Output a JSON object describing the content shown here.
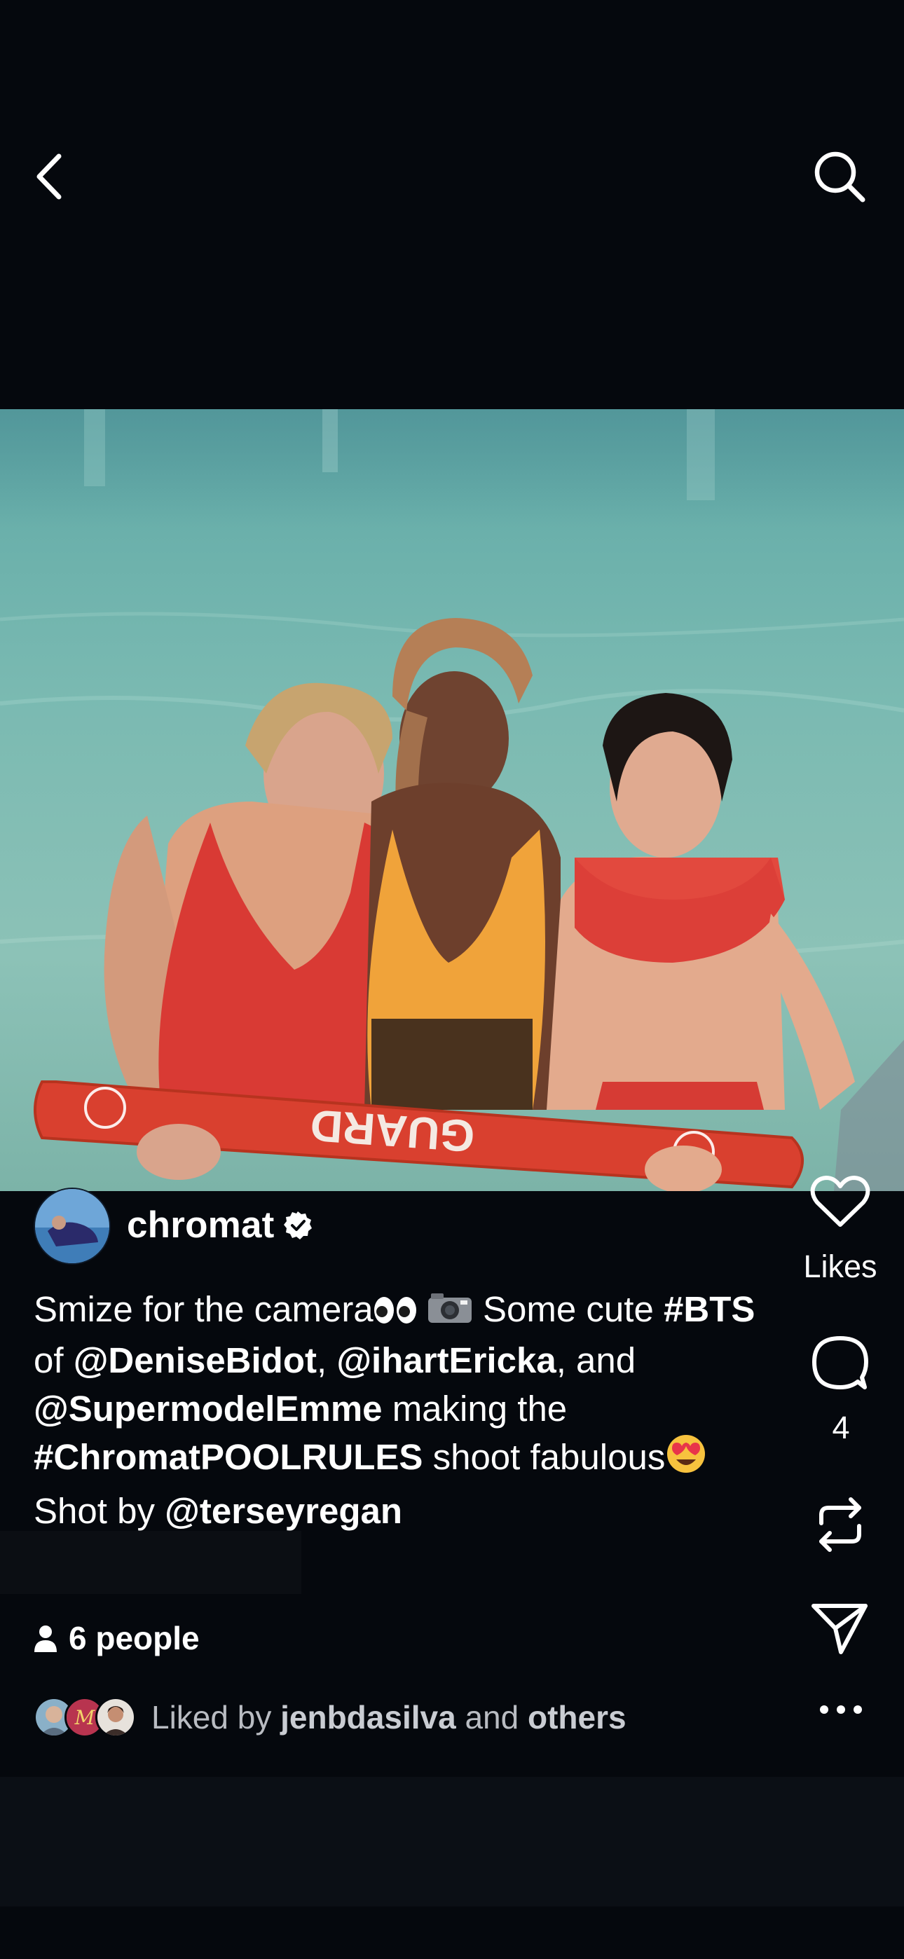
{
  "header": {
    "back_icon": "chevron-left-icon",
    "search_icon": "search-icon"
  },
  "post": {
    "author": {
      "username": "chromat",
      "verified": true
    },
    "caption": {
      "p1": "Smize for the camera",
      "p2": " Some cute",
      "hashtag_bts": "#BTS",
      "of": " of ",
      "mention_1": "@DeniseBidot",
      "comma": ", ",
      "mention_2": "@ihartEricka",
      "and": ", and",
      "mention_3": "@SupermodelEmme",
      "making_the": " making the",
      "hashtag_pool": "#ChromatPOOLRULES",
      "shoot": " shoot fabulous",
      "shot_by": "Shot by ",
      "mention_4": "@terseyregan",
      "emoji_1": "eyes-emoji",
      "emoji_2": "camera-with-flash-emoji",
      "emoji_3": "heart-eyes-emoji"
    },
    "photo_text": "GUARD",
    "tagged": {
      "label": "6 people"
    },
    "liked_by": {
      "prefix": "Liked by ",
      "user": "jenbdasilva",
      "middle": " and ",
      "others": "others"
    }
  },
  "rail": {
    "likes_label": "Likes",
    "comments_count": "4",
    "heart_icon": "heart-icon",
    "comment_icon": "comment-icon",
    "repost_icon": "repost-icon",
    "share_icon": "send-icon",
    "more_icon": "more-icon"
  },
  "colors": {
    "background": "#05080d",
    "text": "#ffffff",
    "muted": "#b9bcc2"
  }
}
